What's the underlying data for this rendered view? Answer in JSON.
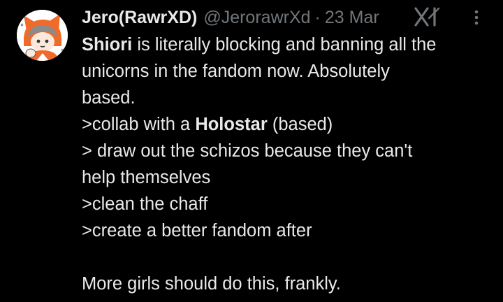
{
  "tweet": {
    "display_name": "Jero(RawrXD)",
    "handle": "@JerorawrXd",
    "separator": "·",
    "date": "23 Mar",
    "avatar_icon": "avatar-image",
    "brand_icon": "x-grok-logo-icon",
    "menu_icon": "more-vertical-icon",
    "lines": [
      {
        "bold": "Shiori",
        "rest": " is literally blocking and banning all the"
      },
      {
        "text": "unicorns in the fandom now. Absolutely"
      },
      {
        "text": "based."
      },
      {
        "pre": ">collab with a ",
        "bold": "Holostar",
        "post": " (based)"
      },
      {
        "text": "> draw out the schizos because they can't"
      },
      {
        "text": "help themselves"
      },
      {
        "text": ">clean the chaff"
      },
      {
        "text": ">create a better fandom after"
      },
      {
        "text": ""
      },
      {
        "text": "More girls should do this, frankly."
      }
    ]
  },
  "colors": {
    "background": "#000000",
    "primary_text": "#e7e9ea",
    "secondary_text": "#71767b",
    "avatar_accent": "#f06a2a"
  }
}
